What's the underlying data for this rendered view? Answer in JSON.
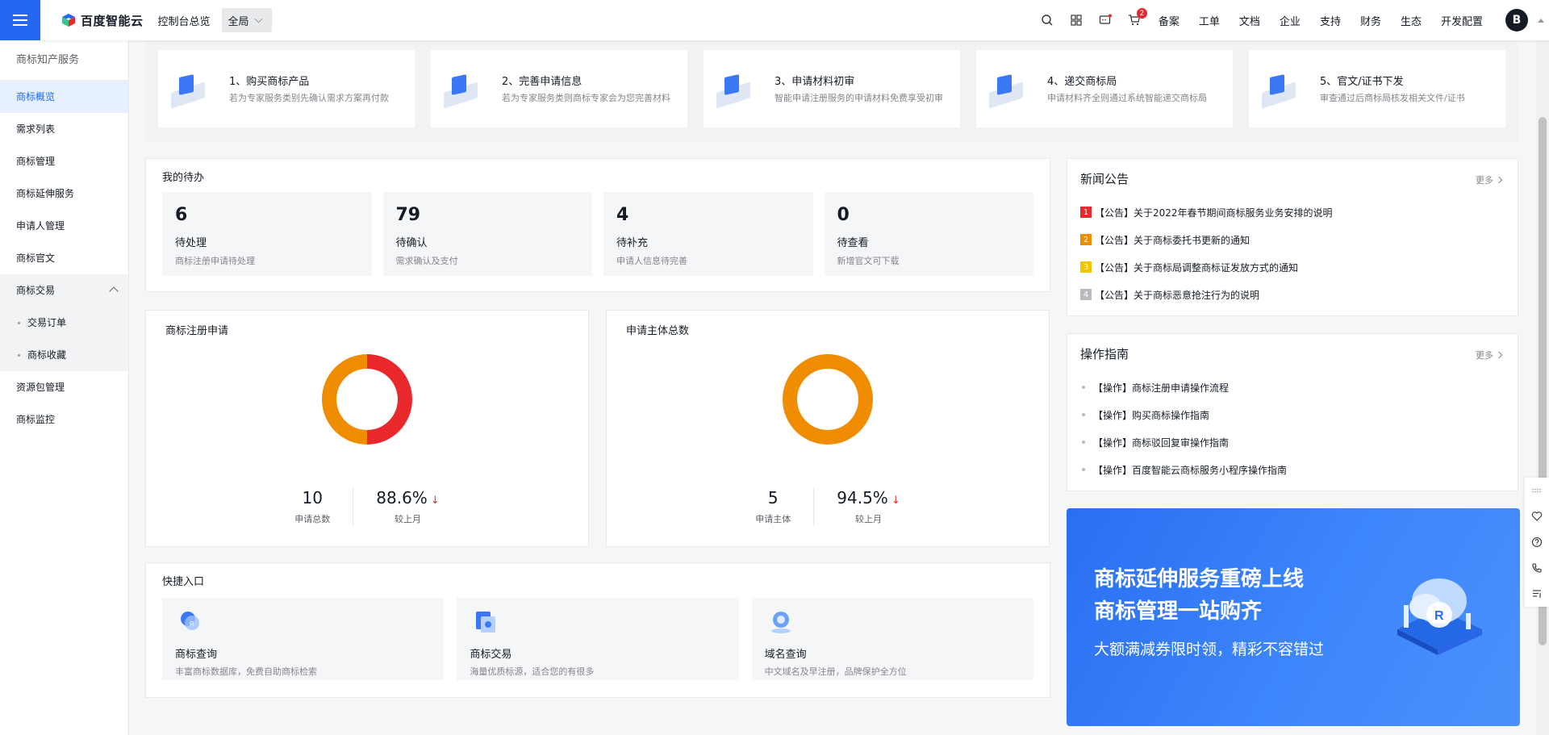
{
  "header": {
    "logo_text": "百度智能云",
    "console_label": "控制台总览",
    "region_label": "全局",
    "cart_badge": "2",
    "links": [
      "备案",
      "工单",
      "文档",
      "企业",
      "支持",
      "财务",
      "生态",
      "开发配置"
    ],
    "avatar_letter": "B",
    "icons": [
      "search-icon",
      "grid-icon",
      "message-icon",
      "cart-icon"
    ]
  },
  "sidebar": {
    "title": "商标知产服务",
    "items": [
      {
        "label": "商标概览",
        "active": true
      },
      {
        "label": "需求列表"
      },
      {
        "label": "商标管理"
      },
      {
        "label": "商标延伸服务"
      },
      {
        "label": "申请人管理"
      },
      {
        "label": "商标官文"
      },
      {
        "label": "商标交易",
        "expanded": true
      },
      {
        "label": "交易订单",
        "sub": true
      },
      {
        "label": "商标收藏",
        "sub": true
      },
      {
        "label": "资源包管理"
      },
      {
        "label": "商标监控"
      }
    ]
  },
  "steps": [
    {
      "title": "1、购买商标产品",
      "desc": "若为专家服务类别先确认需求方案再付款"
    },
    {
      "title": "2、完善申请信息",
      "desc": "若为专家服务类则商标专家会为您完善材料"
    },
    {
      "title": "3、申请材料初审",
      "desc": "智能申请注册服务的申请材料免费享受初审"
    },
    {
      "title": "4、递交商标局",
      "desc": "申请材料齐全则通过系统智能递交商标局"
    },
    {
      "title": "5、官文/证书下发",
      "desc": "审查通过后商标局核发相关文件/证书"
    }
  ],
  "todo": {
    "title": "我的待办",
    "items": [
      {
        "count": "6",
        "label": "待处理",
        "desc": "商标注册申请待处理"
      },
      {
        "count": "79",
        "label": "待确认",
        "desc": "需求确认及支付"
      },
      {
        "count": "4",
        "label": "待补充",
        "desc": "申请人信息待完善"
      },
      {
        "count": "0",
        "label": "待查看",
        "desc": "新增官文可下载"
      }
    ]
  },
  "registration": {
    "title": "商标注册申请",
    "total_value": "10",
    "total_label": "申请总数",
    "ratio_value": "88.6%",
    "ratio_label": "较上月",
    "down_icon": "↓",
    "donut_fraction": 0.5,
    "colors": {
      "primary": "#f08c00",
      "secondary": "#e8282b"
    }
  },
  "applicants": {
    "title": "申请主体总数",
    "total_value": "5",
    "total_label": "申请主体",
    "ratio_value": "94.5%",
    "ratio_label": "较上月",
    "down_icon": "↓",
    "donut_fraction": 1.0,
    "colors": {
      "primary": "#f08c00"
    }
  },
  "quick": {
    "title": "快捷入口",
    "items": [
      {
        "title": "商标查询",
        "desc": "丰富商标数据库，免费自助商标检索"
      },
      {
        "title": "商标交易",
        "desc": "海量优质标源，适合您的有很多"
      },
      {
        "title": "域名查询",
        "desc": "中文域名及早注册，品牌保护全方位"
      }
    ]
  },
  "news": {
    "title": "新闻公告",
    "more": "更多",
    "items": [
      {
        "rank": "1",
        "text": "【公告】关于2022年春节期间商标服务业务安排的说明",
        "color": "#e8282b"
      },
      {
        "rank": "2",
        "text": "【公告】关于商标委托书更新的通知",
        "color": "#f08c00"
      },
      {
        "rank": "3",
        "text": "【公告】关于商标局调整商标证发放方式的通知",
        "color": "#f5c400"
      },
      {
        "rank": "4",
        "text": "【公告】关于商标恶意抢注行为的说明",
        "color": "#b8babf"
      }
    ]
  },
  "guide": {
    "title": "操作指南",
    "more": "更多",
    "items": [
      "【操作】商标注册申请操作流程",
      "【操作】购买商标操作指南",
      "【操作】商标驳回复审操作指南",
      "【操作】百度智能云商标服务小程序操作指南"
    ]
  },
  "banner": {
    "line1": "商标延伸服务重磅上线",
    "line2": "商标管理一站购齐",
    "line3": "大额满减券限时领，精彩不容错过",
    "badge_letter": "R"
  },
  "right_tools": [
    "drag-icon",
    "heart-icon",
    "help-icon",
    "phone-icon",
    "feedback-icon"
  ]
}
